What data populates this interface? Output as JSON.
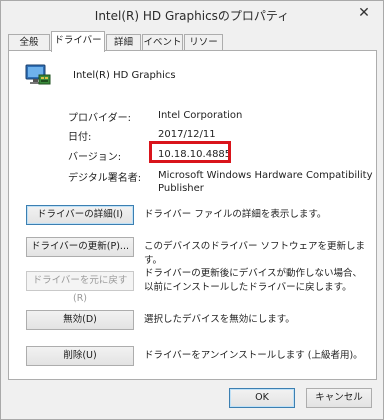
{
  "window": {
    "title": "Intel(R) HD Graphicsのプロパティ",
    "close_glyph": "✕"
  },
  "tabs": [
    {
      "label": "全般"
    },
    {
      "label": "ドライバー"
    },
    {
      "label": "詳細"
    },
    {
      "label": "イベント"
    },
    {
      "label": "リソース"
    }
  ],
  "device": {
    "name": "Intel(R) HD Graphics",
    "icon": "display-adapter-icon"
  },
  "properties": [
    {
      "label": "プロバイダー:",
      "value": "Intel Corporation"
    },
    {
      "label": "日付:",
      "value": "2017/12/11"
    },
    {
      "label": "バージョン:",
      "value": "10.18.10.4885"
    },
    {
      "label": "デジタル署名者:",
      "value": "Microsoft Windows Hardware Compatibility Publisher"
    }
  ],
  "actions": [
    {
      "label": "ドライバーの詳細(I)",
      "description": "ドライバー ファイルの詳細を表示します。"
    },
    {
      "label": "ドライバーの更新(P)...",
      "description": "このデバイスのドライバー ソフトウェアを更新します。"
    },
    {
      "label": "ドライバーを元に戻す(R)",
      "description": "ドライバーの更新後にデバイスが動作しない場合、以前にインストールしたドライバーに戻します。"
    },
    {
      "label": "無効(D)",
      "description": "選択したデバイスを無効にします。"
    },
    {
      "label": "削除(U)",
      "description": "ドライバーをアンインストールします (上級者用)。"
    }
  ],
  "footer": {
    "ok_label": "OK",
    "cancel_label": "キャンセル"
  },
  "colors": {
    "highlight": "#d9141b",
    "focus_border": "#3c7fb1"
  }
}
